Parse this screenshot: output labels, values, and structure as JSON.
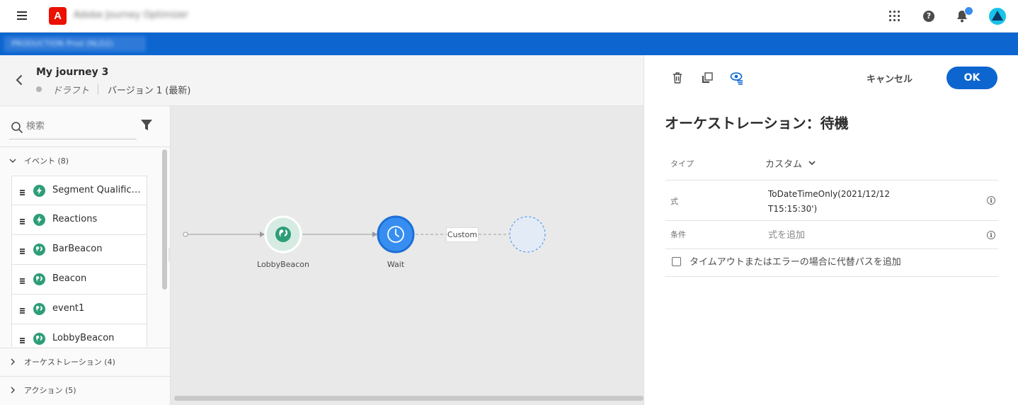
{
  "app": {
    "name": "Adobe Journey Optimizer",
    "logo_letter": "A"
  },
  "org": {
    "label": "PRODUCTION  Prod (NLD2)"
  },
  "journey": {
    "title": "My journey 3",
    "status": "ドラフト",
    "version": "バージョン 1 (最新)"
  },
  "left_panel": {
    "search_placeholder": "検索",
    "categories": {
      "events": "イベント (8)",
      "orchestration": "オーケストレーション (4)",
      "actions": "アクション (5)"
    },
    "events": [
      {
        "label": "Segment Qualificati...",
        "icon": "lightning-icon"
      },
      {
        "label": "Reactions",
        "icon": "lightning-icon"
      },
      {
        "label": "BarBeacon",
        "icon": "globe-icon"
      },
      {
        "label": "Beacon",
        "icon": "globe-icon"
      },
      {
        "label": "event1",
        "icon": "globe-icon"
      },
      {
        "label": "LobbyBeacon",
        "icon": "globe-icon"
      }
    ]
  },
  "canvas": {
    "nodes": {
      "lobby_beacon": "LobbyBeacon",
      "wait": "Wait"
    },
    "path_label": "Custom"
  },
  "right_panel": {
    "cancel_label": "キャンセル",
    "ok_label": "OK",
    "title": "オーケストレーション：待機",
    "type_label": "タイプ",
    "type_value": "カスタム",
    "expression_label": "式",
    "expression_value": "ToDateTimeOnly(2021/12/12 T15:15:30')",
    "condition_label": "条件",
    "condition_placeholder": "式を追加",
    "timeout_checkbox_label": "タイムアウトまたはエラーの場合に代替パスを追加"
  },
  "colors": {
    "accent": "#0d66d0",
    "event_green": "#2d9d78",
    "wait_blue": "#378ef0",
    "brand_red": "#eb1000"
  }
}
